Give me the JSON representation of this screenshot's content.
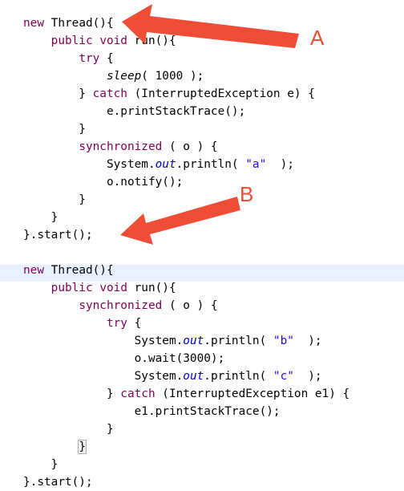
{
  "colors": {
    "keyword": "#7f0055",
    "static_field": "#0000c0",
    "string": "#2a00ff",
    "text": "#000000",
    "current_line": "#e8f2fe",
    "annotation": "#f04d36"
  },
  "code": {
    "lines": [
      [
        {
          "t": "new",
          "c": "kw"
        },
        {
          "t": " Thread(){"
        }
      ],
      [
        {
          "t": "    "
        },
        {
          "t": "public",
          "c": "kw"
        },
        {
          "t": " "
        },
        {
          "t": "void",
          "c": "kw"
        },
        {
          "t": " run(){"
        }
      ],
      [
        {
          "t": "        "
        },
        {
          "t": "try",
          "c": "kw"
        },
        {
          "t": " {"
        }
      ],
      [
        {
          "t": "            "
        },
        {
          "t": "sleep",
          "c": "it"
        },
        {
          "t": "( 1000 );"
        }
      ],
      [
        {
          "t": "        } "
        },
        {
          "t": "catch",
          "c": "kw"
        },
        {
          "t": " (InterruptedException e) {"
        }
      ],
      [
        {
          "t": "            e.printStackTrace();"
        }
      ],
      [
        {
          "t": "        }"
        }
      ],
      [
        {
          "t": "        "
        },
        {
          "t": "synchronized",
          "c": "kw"
        },
        {
          "t": " ( o ) {"
        }
      ],
      [
        {
          "t": "            System."
        },
        {
          "t": "out",
          "c": "fld"
        },
        {
          "t": ".println( "
        },
        {
          "t": "\"a\"",
          "c": "str"
        },
        {
          "t": "  );"
        }
      ],
      [
        {
          "t": "            o.notify();"
        }
      ],
      [
        {
          "t": "        }"
        }
      ],
      [
        {
          "t": "    }"
        }
      ],
      [
        {
          "t": "}.start();"
        }
      ],
      [],
      [
        {
          "t": "new",
          "c": "kw"
        },
        {
          "t": " Thread(){"
        }
      ],
      [
        {
          "t": "    "
        },
        {
          "t": "public",
          "c": "kw"
        },
        {
          "t": " "
        },
        {
          "t": "void",
          "c": "kw"
        },
        {
          "t": " run(){"
        }
      ],
      [
        {
          "t": "        "
        },
        {
          "t": "synchronized",
          "c": "kw"
        },
        {
          "t": " ( o ) {"
        }
      ],
      [
        {
          "t": "            "
        },
        {
          "t": "try",
          "c": "kw"
        },
        {
          "t": " {"
        }
      ],
      [
        {
          "t": "                System."
        },
        {
          "t": "out",
          "c": "fld"
        },
        {
          "t": ".println( "
        },
        {
          "t": "\"b\"",
          "c": "str"
        },
        {
          "t": "  );"
        }
      ],
      [
        {
          "t": "                o.wait(3000);"
        }
      ],
      [
        {
          "t": "                System."
        },
        {
          "t": "out",
          "c": "fld"
        },
        {
          "t": ".println( "
        },
        {
          "t": "\"c\"",
          "c": "str"
        },
        {
          "t": "  );"
        }
      ],
      [
        {
          "t": "            } "
        },
        {
          "t": "catch",
          "c": "kw"
        },
        {
          "t": " (InterruptedException e1) {"
        }
      ],
      [
        {
          "t": "                e1.printStackTrace();"
        }
      ],
      [
        {
          "t": "            }"
        }
      ],
      [
        {
          "t": "        "
        },
        {
          "t": "}",
          "c": "box"
        }
      ],
      [
        {
          "t": "    }"
        }
      ],
      [
        {
          "t": "}.start();"
        }
      ]
    ]
  },
  "annotations": {
    "label_a": "A",
    "label_b": "B"
  }
}
